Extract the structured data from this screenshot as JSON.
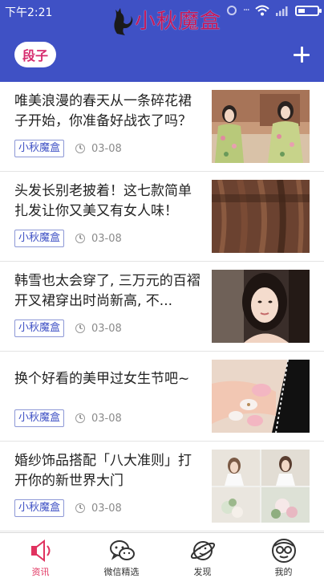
{
  "status_bar": {
    "time": "下午2:21"
  },
  "brand": {
    "title": "小秋魔盒"
  },
  "header": {
    "active_tab": "段子"
  },
  "articles": [
    {
      "title": "唯美浪漫的春天从一条碎花裙子开始，你准备好战衣了吗？",
      "source": "小秋魔盒",
      "date": "03-08"
    },
    {
      "title": "头发长别老披着！这七款简单扎发让你又美又有女人味！",
      "source": "小秋魔盒",
      "date": "03-08"
    },
    {
      "title": "韩雪也太会穿了, 三万元的百褶开叉裙穿出时尚新高, 不...",
      "source": "小秋魔盒",
      "date": "03-08"
    },
    {
      "title": "换个好看的美甲过女生节吧~",
      "source": "小秋魔盒",
      "date": "03-08"
    },
    {
      "title": "婚纱饰品搭配「八大准则」打开你的新世界大门",
      "source": "小秋魔盒",
      "date": "03-08"
    }
  ],
  "bottom_nav": [
    {
      "label": "资讯",
      "icon": "speaker-icon",
      "active": true
    },
    {
      "label": "微信精选",
      "icon": "wechat-icon",
      "active": false
    },
    {
      "label": "发现",
      "icon": "planet-icon",
      "active": false
    },
    {
      "label": "我的",
      "icon": "glasses-face-icon",
      "active": false
    }
  ],
  "colors": {
    "header_blue": "#3f51c5",
    "accent_pink": "#d62b6e",
    "tag_blue": "#3f51c5"
  }
}
